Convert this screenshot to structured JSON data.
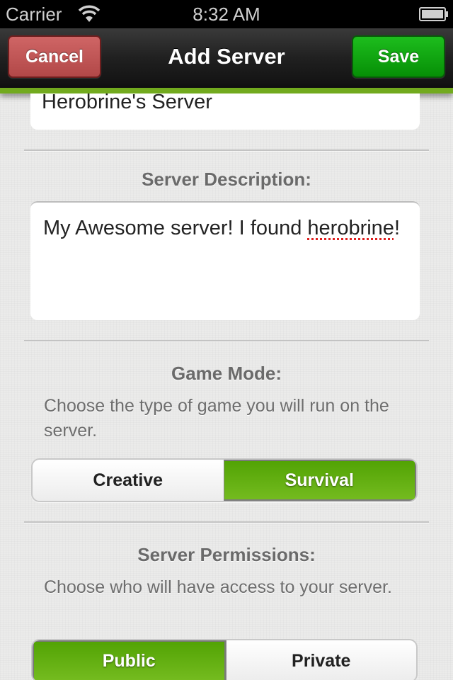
{
  "status_bar": {
    "carrier": "Carrier",
    "wifi_icon": "wifi-icon",
    "time": "8:32 AM",
    "battery_icon": "battery-full-icon"
  },
  "nav_bar": {
    "title": "Add Server",
    "cancel_label": "Cancel",
    "save_label": "Save",
    "colors": {
      "cancel": "#c05656",
      "save": "#0aa30a",
      "accent": "#72aa1e"
    }
  },
  "form": {
    "server_name": {
      "value": "Herobrine's Server"
    },
    "description": {
      "label": "Server Description:",
      "value_part1": "My Awesome server! I found ",
      "value_misspelled": "herobrine",
      "value_part2": "!"
    },
    "game_mode": {
      "label": "Game Mode:",
      "description": "Choose the type of game you will run on the server.",
      "options": [
        "Creative",
        "Survival"
      ],
      "selected": "Survival"
    },
    "permissions": {
      "label": "Server Permissions:",
      "description": "Choose who will have access to your server.",
      "options": [
        "Public",
        "Private"
      ],
      "selected": "Public"
    }
  }
}
